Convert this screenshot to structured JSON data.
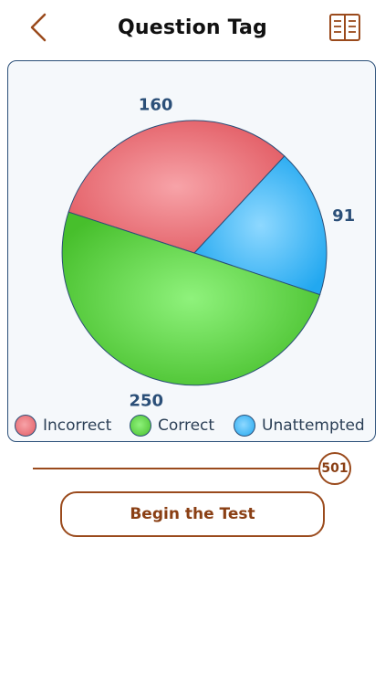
{
  "header": {
    "title": "Question Tag",
    "back_icon": "chevron-left-icon",
    "book_icon": "open-book-icon"
  },
  "chart_data": {
    "type": "pie",
    "categories": [
      "Incorrect",
      "Correct",
      "Unattempted"
    ],
    "values": [
      160,
      250,
      91
    ],
    "colors": [
      "#e9666e",
      "#5ccb3e",
      "#3db6f5"
    ],
    "data_labels": [
      "160",
      "250",
      "91"
    ],
    "legend_position": "bottom"
  },
  "slider": {
    "value": 501
  },
  "begin_button": {
    "label": "Begin the Test"
  },
  "colors": {
    "accent": "#9a4a1c",
    "card_border": "#2b4f78",
    "label_text": "#2b3f56"
  }
}
